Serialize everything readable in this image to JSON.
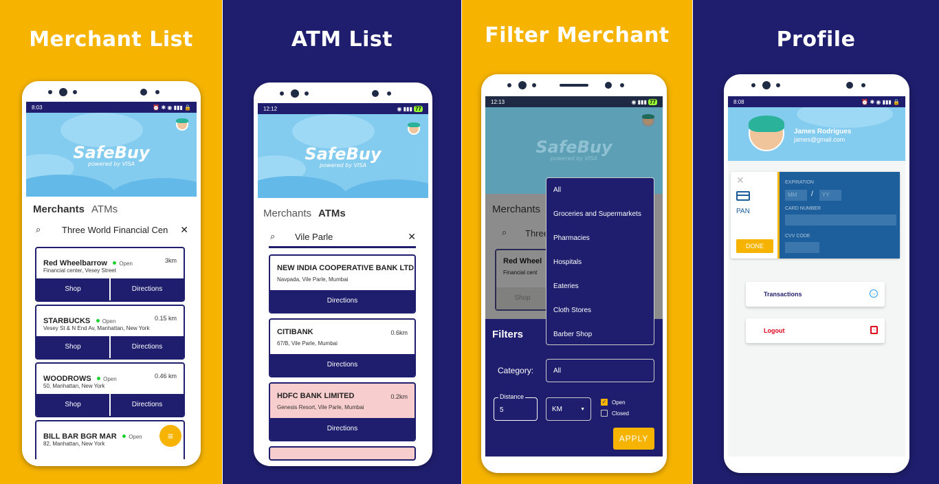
{
  "panels": [
    {
      "title": "Merchant List"
    },
    {
      "title": "ATM List"
    },
    {
      "title": "Filter Merchant"
    },
    {
      "title": "Profile"
    }
  ],
  "brand": {
    "logo": "SafeBuy",
    "powered": "powered by VISA"
  },
  "merchant_list": {
    "time": "8:03",
    "tabs": {
      "merchants": "Merchants",
      "atms": "ATMs"
    },
    "search_value": "Three World Financial Cen",
    "cards": [
      {
        "name": "Red Wheelbarrow",
        "status": "Open",
        "dist": "3km",
        "addr": "Financial center, Vesey Street",
        "shop": "Shop",
        "dir": "Directions"
      },
      {
        "name": "STARBUCKS",
        "status": "Open",
        "dist": "0.15 km",
        "addr": "Vesey St & N End Av, Manhattan, New York",
        "shop": "Shop",
        "dir": "Directions"
      },
      {
        "name": "WOODROWS",
        "status": "Open",
        "dist": "0.46 km",
        "addr": "50, Manhattan, New York",
        "shop": "Shop",
        "dir": "Directions"
      },
      {
        "name": "BILL BAR BGR MAR",
        "status": "Open",
        "dist": "0.",
        "addr": "82, Manhattan, New York"
      }
    ]
  },
  "atm_list": {
    "time": "12:12",
    "battery": "77",
    "tabs": {
      "merchants": "Merchants",
      "atms": "ATMs"
    },
    "search_value": "Vile Parle",
    "cards": [
      {
        "name": "NEW INDIA COOPERATIVE BANK LTD",
        "dist": "",
        "addr": "Navpada, Vile Parle, Mumbai",
        "dir": "Directions"
      },
      {
        "name": "CITIBANK",
        "dist": "0.6km",
        "addr": "67/B, Vile Parle, Mumbai",
        "dir": "Directions"
      },
      {
        "name": "HDFC BANK LIMITED",
        "dist": "0.2km",
        "addr": "Genesis Resort, Vile Parle, Mumbai",
        "dir": "Directions"
      }
    ]
  },
  "filter": {
    "time": "12:13",
    "battery": "77",
    "bg_tab": "Merchants",
    "bg_search": "Three",
    "bg_card_name": "Red Wheel",
    "bg_card_addr": "Financial cent",
    "bg_shop": "Shop",
    "title": "Filters",
    "category_label": "Category:",
    "category_value": "All",
    "options": [
      "All",
      "Groceries and Supermarkets",
      "Pharmacies",
      "Hospitals",
      "Eateries",
      "Cloth Stores",
      "Barber Shop"
    ],
    "distance_label": "Distance",
    "distance_value": "5",
    "unit": "KM",
    "open_label": "Open",
    "closed_label": "Closed",
    "open_checked": true,
    "closed_checked": false,
    "apply": "APPLY"
  },
  "profile": {
    "time": "8:08",
    "name": "James Rodrigues",
    "email": "james@gmail.com",
    "card": {
      "pan": "PAN",
      "done": "DONE",
      "expiration": "EXPIRATION",
      "mm": "MM",
      "sep": "/",
      "yy": "YY",
      "card_number": "CARD NUMBER",
      "cvv": "CVV CODE"
    },
    "transactions": "Transactions",
    "logout": "Logout"
  },
  "colors": {
    "yellow": "#f6b300",
    "navy": "#1f1e6e",
    "sky": "#84cbf0",
    "red": "#e0001b",
    "pink": "#f8cdcd"
  }
}
